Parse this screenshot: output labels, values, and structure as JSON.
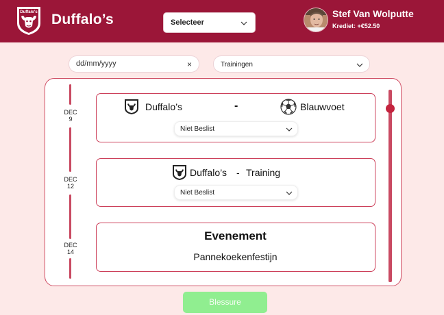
{
  "header": {
    "brand": "Duffalo’s",
    "select_label": "Selecteer",
    "user_name": "Stef Van Wolputte",
    "credit": "Krediet: +€52.50",
    "logo_text": "Duffalo's",
    "brand_color": "#9b1638"
  },
  "filters": {
    "date_placeholder": "dd/mm/yyyy",
    "clear_icon": "×",
    "type_selected": "Trainingen"
  },
  "events": [
    {
      "date_month": "DEC",
      "date_day": "9",
      "kind": "match",
      "home_team": "Duffalo’s",
      "separator": "-",
      "away_team": "Blauwvoet",
      "status": "Niet Beslist"
    },
    {
      "date_month": "DEC",
      "date_day": "12",
      "kind": "training",
      "team": "Duffalo’s",
      "separator": "-",
      "type": "Training",
      "status": "Niet Beslist"
    },
    {
      "date_month": "DEC",
      "date_day": "14",
      "kind": "event",
      "title": "Evenement",
      "name": "Pannekoekenfestijn"
    }
  ],
  "actions": {
    "injury_label": "Blessure",
    "injury_color": "#90ee90"
  },
  "colors": {
    "page_bg": "#fde9e8",
    "accent": "#cc3f59",
    "timeline": "#c94a62"
  }
}
